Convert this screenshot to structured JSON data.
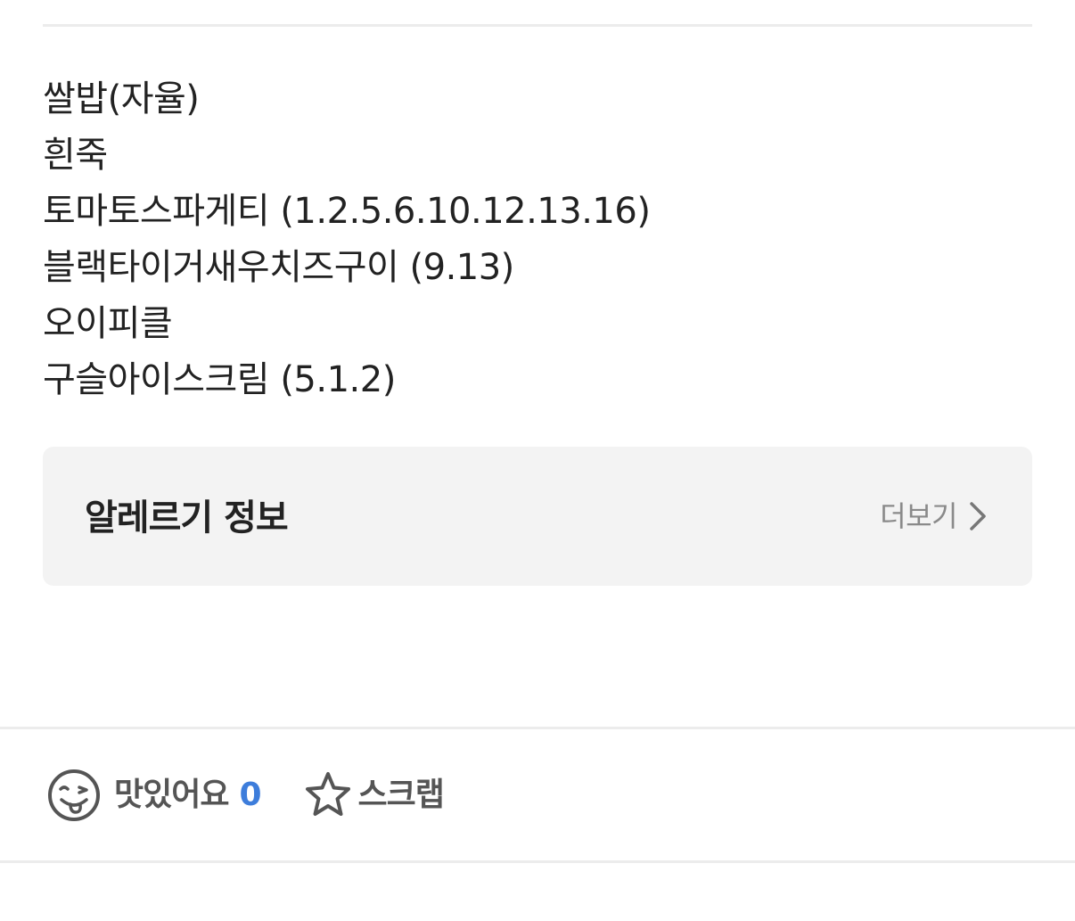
{
  "menu": {
    "items": [
      "쌀밥(자율)",
      "흰죽",
      "토마토스파게티 (1.2.5.6.10.12.13.16)",
      "블랙타이거새우치즈구이 (9.13)",
      "오이피클",
      "구슬아이스크림 (5.1.2)"
    ]
  },
  "allergy": {
    "title": "알레르기 정보",
    "more_label": "더보기",
    "more_icon": "chevron-right-icon"
  },
  "actions": {
    "like_label": "맛있어요",
    "like_count": "0",
    "like_icon": "yummy-face-icon",
    "scrap_label": "스크랩",
    "scrap_icon": "star-outline-icon"
  },
  "colors": {
    "accent_count": "#3d7ddb",
    "card_background": "#f3f3f3",
    "divider": "#ececec",
    "muted_text": "#8a8a8a",
    "icon_stroke": "#555555"
  }
}
